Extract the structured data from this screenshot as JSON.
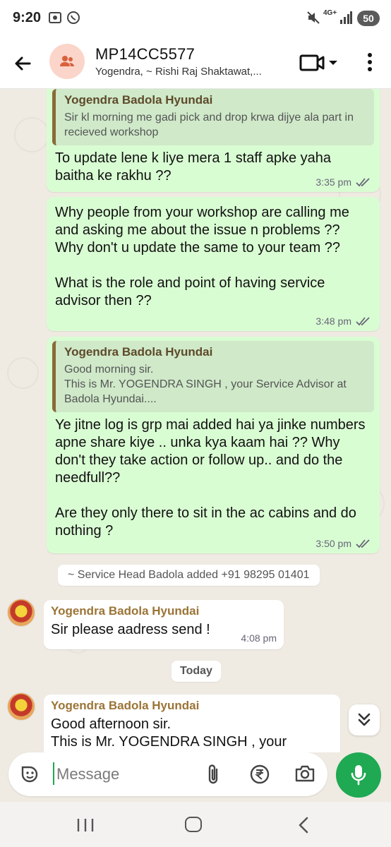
{
  "status_bar": {
    "time": "9:20",
    "network": "4G+",
    "battery": "50"
  },
  "header": {
    "title": "MP14CC5577",
    "subtitle": "Yogendra, ~ Rishi Raj Shaktawat,..."
  },
  "messages": {
    "m1": {
      "quote_author": "Yogendra Badola Hyundai",
      "quote_text": "Sir kl morning me gadi pick and drop krwa dijye ala part in recieved workshop",
      "text": "To update lene k liye mera 1 staff apke yaha baitha ke rakhu ??",
      "time": "3:35 pm"
    },
    "m2": {
      "text": "Why people from your workshop are calling me and asking me about the issue n problems ??\nWhy don't u update the same to your team  ??\n\nWhat is the role and point of having service advisor then  ??",
      "time": "3:48 pm"
    },
    "m3": {
      "quote_author": "Yogendra Badola Hyundai",
      "quote_text": "Good morning sir.\nThis is Mr. YOGENDRA SINGH , your Service Advisor at Badola Hyundai....",
      "text": "Ye jitne log is grp mai added hai ya jinke numbers apne share kiye .. unka kya kaam hai  ??  Why don't they take action or follow up.. and do the needfull??\n\nAre they only there to sit in the ac cabins and do nothing   ?",
      "time": "3:50 pm"
    },
    "system": "~ Service Head Badola added +91 98295 01401",
    "m4": {
      "sender": "Yogendra Badola Hyundai",
      "text": "Sir please aadress send !",
      "time": "4:08 pm"
    },
    "day_divider": "Today",
    "m5": {
      "sender": "Yogendra Badola Hyundai",
      "text": "Good afternoon sir.\nThis is Mr. YOGENDRA SINGH , your"
    }
  },
  "composer": {
    "placeholder": "Message"
  },
  "colors": {
    "outgoing_bubble": "#d9fdd3",
    "accent_green": "#1ea952",
    "sender_name": "#9b7436"
  },
  "icons": [
    "back-arrow-icon",
    "group-icon",
    "video-call-icon",
    "more-options-icon",
    "double-tick-icon",
    "scroll-down-icon",
    "sticker-icon",
    "attach-icon",
    "rupee-icon",
    "camera-icon",
    "mic-icon"
  ]
}
